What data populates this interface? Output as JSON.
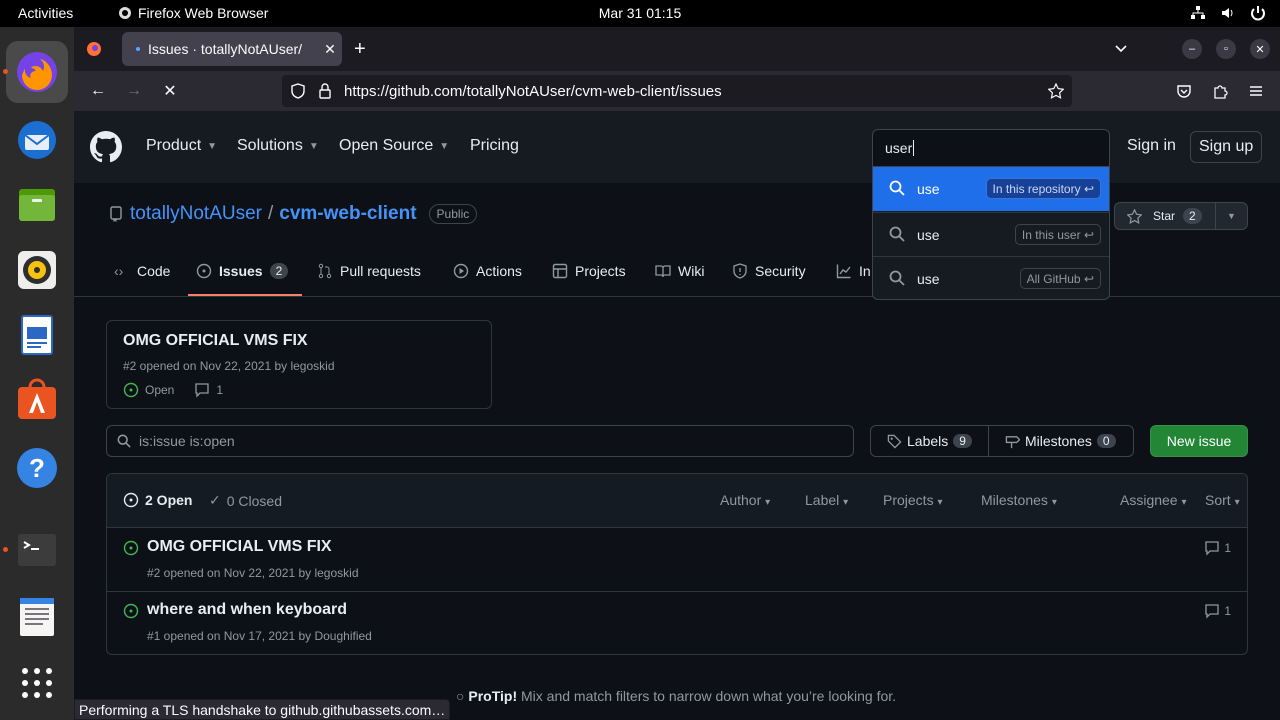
{
  "system": {
    "activities": "Activities",
    "app_name": "Firefox Web Browser",
    "clock": "Mar 31  01:15"
  },
  "browser": {
    "tab_title": "Issues · totallyNotAUser/",
    "url": "https://github.com/totallyNotAUser/cvm-web-client/issues",
    "status": "Performing a TLS handshake to github.githubassets.com…"
  },
  "github_header": {
    "nav": [
      "Product",
      "Solutions",
      "Open Source",
      "Pricing"
    ],
    "search_value": "user",
    "sign_in": "Sign in",
    "sign_up": "Sign up",
    "suggestions": [
      {
        "text": "use",
        "scope": "In this repository"
      },
      {
        "text": "use",
        "scope": "In this user"
      },
      {
        "text": "use",
        "scope": "All GitHub"
      }
    ]
  },
  "repo": {
    "owner": "totallyNotAUser",
    "separator": "/",
    "name": "cvm-web-client",
    "visibility": "Public",
    "star_label": "Star",
    "star_count": "2",
    "tabs": [
      {
        "label": "Code"
      },
      {
        "label": "Issues",
        "count": "2"
      },
      {
        "label": "Pull requests"
      },
      {
        "label": "Actions"
      },
      {
        "label": "Projects"
      },
      {
        "label": "Wiki"
      },
      {
        "label": "Security"
      },
      {
        "label": "In"
      }
    ]
  },
  "pinned_issue": {
    "title": "OMG OFFICIAL VMS FIX",
    "meta": "#2 opened on Nov 22, 2021 by legoskid",
    "state": "Open",
    "comments": "1"
  },
  "filters": {
    "query": "is:issue is:open",
    "labels": "Labels",
    "labels_count": "9",
    "milestones": "Milestones",
    "milestones_count": "0",
    "new_issue": "New issue"
  },
  "issue_list": {
    "open": "2 Open",
    "closed": "0 Closed",
    "filters": [
      "Author",
      "Label",
      "Projects",
      "Milestones",
      "Assignee",
      "Sort"
    ],
    "issues": [
      {
        "title": "OMG OFFICIAL VMS FIX",
        "meta": "#2 opened on Nov 22, 2021 by legoskid",
        "comments": "1"
      },
      {
        "title": "where and when keyboard",
        "meta": "#1 opened on Nov 17, 2021 by Doughified",
        "comments": "1"
      }
    ]
  },
  "protip": {
    "label": "ProTip!",
    "text": " Mix and match filters to narrow down what you’re looking for."
  },
  "colors": {
    "bg": "#0d1117",
    "accent_blue": "#1f6feb",
    "open_green": "#3fb950",
    "tab_underline": "#f78166",
    "primary_button": "#238636"
  }
}
